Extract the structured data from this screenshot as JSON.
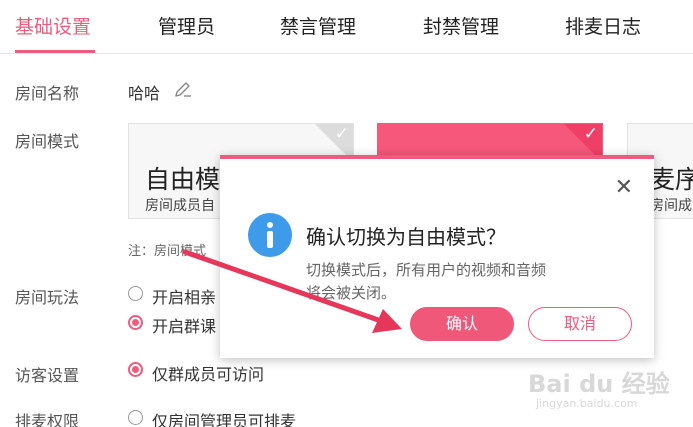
{
  "tabs": [
    {
      "label": "基础设置",
      "active": true
    },
    {
      "label": "管理员"
    },
    {
      "label": "禁言管理"
    },
    {
      "label": "封禁管理"
    },
    {
      "label": "排麦日志"
    }
  ],
  "room_name": {
    "label": "房间名称",
    "value": "哈哈"
  },
  "room_mode": {
    "label": "房间模式",
    "cards": [
      {
        "title": "自由模",
        "desc": "房间成员自"
      },
      {
        "title": "",
        "desc": "",
        "selected": true
      },
      {
        "title": "麦序",
        "desc": "房间成"
      }
    ],
    "note": "注：房间模式"
  },
  "room_play": {
    "label": "房间玩法",
    "options": [
      {
        "label": "开启相亲",
        "checked": false
      },
      {
        "label": "开启群课",
        "checked": true
      }
    ]
  },
  "visitor": {
    "label": "访客设置",
    "option": "仅群成员可访问"
  },
  "mic_permission": {
    "label": "排麦权限",
    "option": "仅房间管理员可排麦"
  },
  "modal": {
    "title": "确认切换为自由模式？",
    "message": "切换模式后，所有用户的视频和音频将会被关闭。",
    "confirm_label": "确认",
    "cancel_label": "取消"
  },
  "watermark": {
    "main": "Bai du 经验",
    "sub": "jingyan.baidu.com"
  },
  "colors": {
    "accent": "#ef5b7d",
    "info": "#3d9be9",
    "arrow": "#e6375a"
  }
}
